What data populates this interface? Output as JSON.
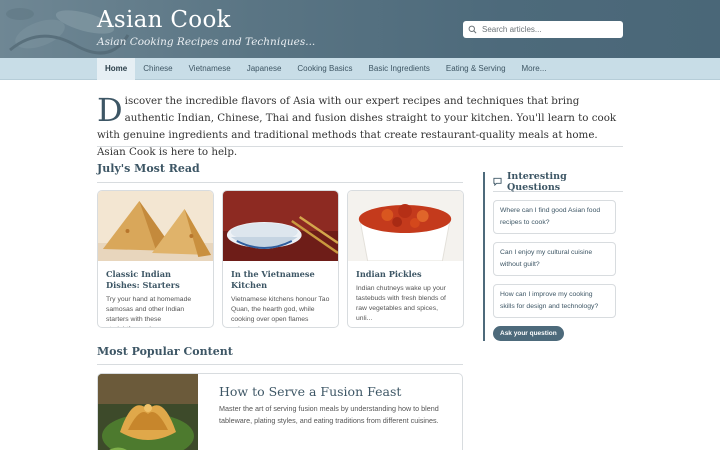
{
  "header": {
    "site_title": "Asian Cook",
    "tagline": "Asian Cooking Recipes and Techniques...",
    "search_placeholder": "Search articles..."
  },
  "nav": {
    "items": [
      "Home",
      "Chinese",
      "Vietnamese",
      "Japanese",
      "Cooking Basics",
      "Basic Ingredients",
      "Eating & Serving",
      "More..."
    ],
    "active": "Home"
  },
  "intro": {
    "dropcap": "D",
    "text": "iscover the incredible flavors of Asia with our expert recipes and techniques that bring authentic Indian, Chinese, Thai and fusion dishes straight to your kitchen. You'll learn to cook with genuine ingredients and traditional methods that create restaurant-quality meals at home. Asian Cook is here to help."
  },
  "most_read": {
    "title": "July's Most Read",
    "cards": [
      {
        "title": "Classic Indian Dishes: Starters",
        "text": "Try your hand at homemade samosas and other Indian starters with these straightforward...",
        "image": "samosas"
      },
      {
        "title": "In the Vietnamese Kitchen",
        "text": "Vietnamese kitchens honour Tao Quan, the hearth god, while cooking over open flames using...",
        "image": "bowl-chopsticks"
      },
      {
        "title": "Indian Pickles",
        "text": "Indian chutneys wake up your tastebuds with fresh blends of raw vegetables and spices, unli...",
        "image": "pickles"
      }
    ]
  },
  "sidebar": {
    "title": "Interesting Questions",
    "icon": "chat-bubble-icon",
    "questions": [
      "Where can I find good Asian food recipes to cook?",
      "Can I enjoy my cultural cuisine without guilt?",
      "How can I improve my cooking skills for design and technology?"
    ],
    "ask_button": "Ask your question"
  },
  "popular": {
    "title": "Most Popular Content",
    "feature": {
      "title": "How to Serve a Fusion Feast",
      "text": "Master the art of serving fusion meals by understanding how to blend tableware, plating styles, and eating traditions from different cuisines.",
      "image": "fried-wontons"
    }
  },
  "colors": {
    "header": "#4d6a7b",
    "nav": "#c8dde7",
    "accent": "#3d5665"
  }
}
